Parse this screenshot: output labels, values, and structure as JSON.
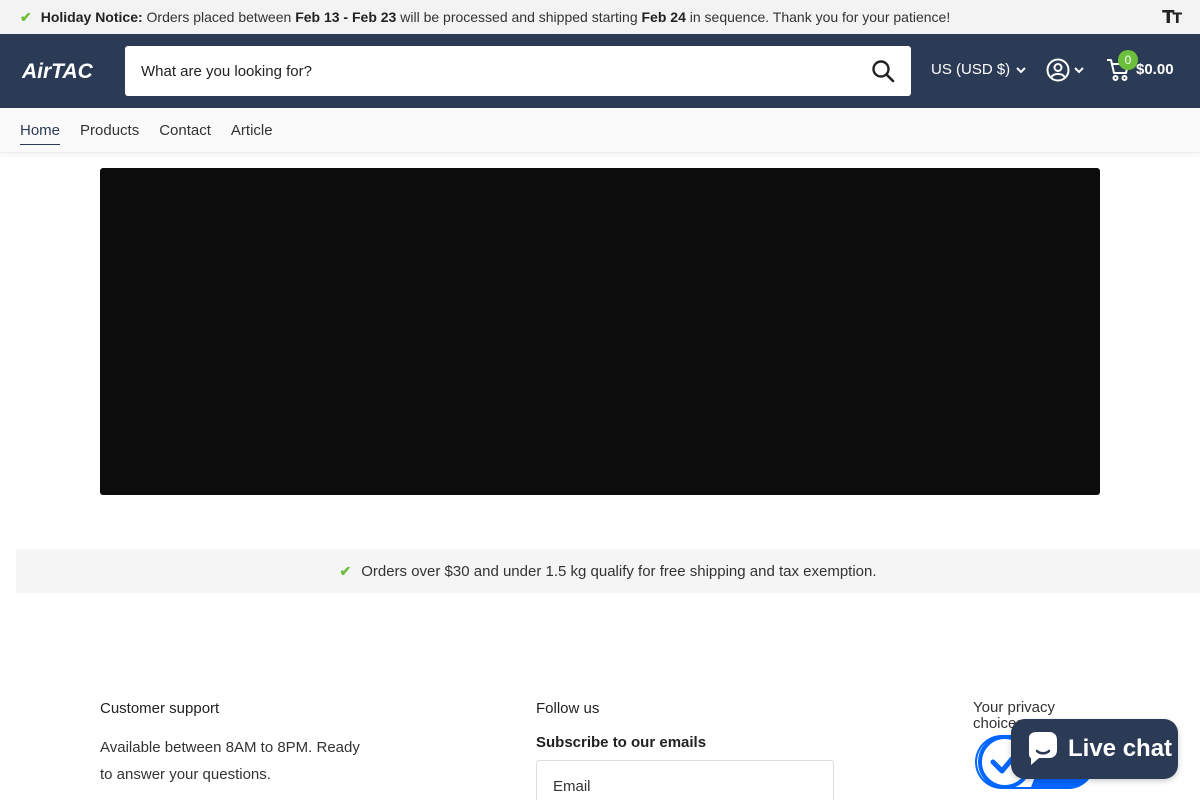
{
  "announcement": {
    "label": "Holiday Notice:",
    "text_1": "Orders placed between",
    "date_range": "Feb 13 - Feb 23",
    "text_2": "will be processed and shipped starting",
    "start_date": "Feb 24",
    "text_3": "in sequence. Thank you for your patience!",
    "icon": "check-icon",
    "accessibility_icon": "text-size-icon"
  },
  "header": {
    "logo_text": "AirTAC",
    "search_placeholder": "What are you looking for?",
    "currency": "US (USD $)",
    "cart_count": "0",
    "cart_total": "$0.00",
    "colors": {
      "header_bg": "#2b3a55",
      "accent": "#6cbf3a"
    }
  },
  "nav": {
    "items": [
      {
        "label": "Home",
        "active": true
      },
      {
        "label": "Products",
        "active": false
      },
      {
        "label": "Contact",
        "active": false
      },
      {
        "label": "Article",
        "active": false
      }
    ]
  },
  "shipping_notice": "Orders over $30 and under 1.5 kg qualify for free shipping and tax exemption.",
  "footer": {
    "support_title": "Customer support",
    "support_text": "Available between 8AM to 8PM. Ready to answer your questions.",
    "follow_title": "Follow us",
    "subscribe_title": "Subscribe to our emails",
    "email_placeholder": "Email",
    "privacy_title": "Your privacy choices"
  },
  "live_chat": {
    "label": "Live chat"
  }
}
